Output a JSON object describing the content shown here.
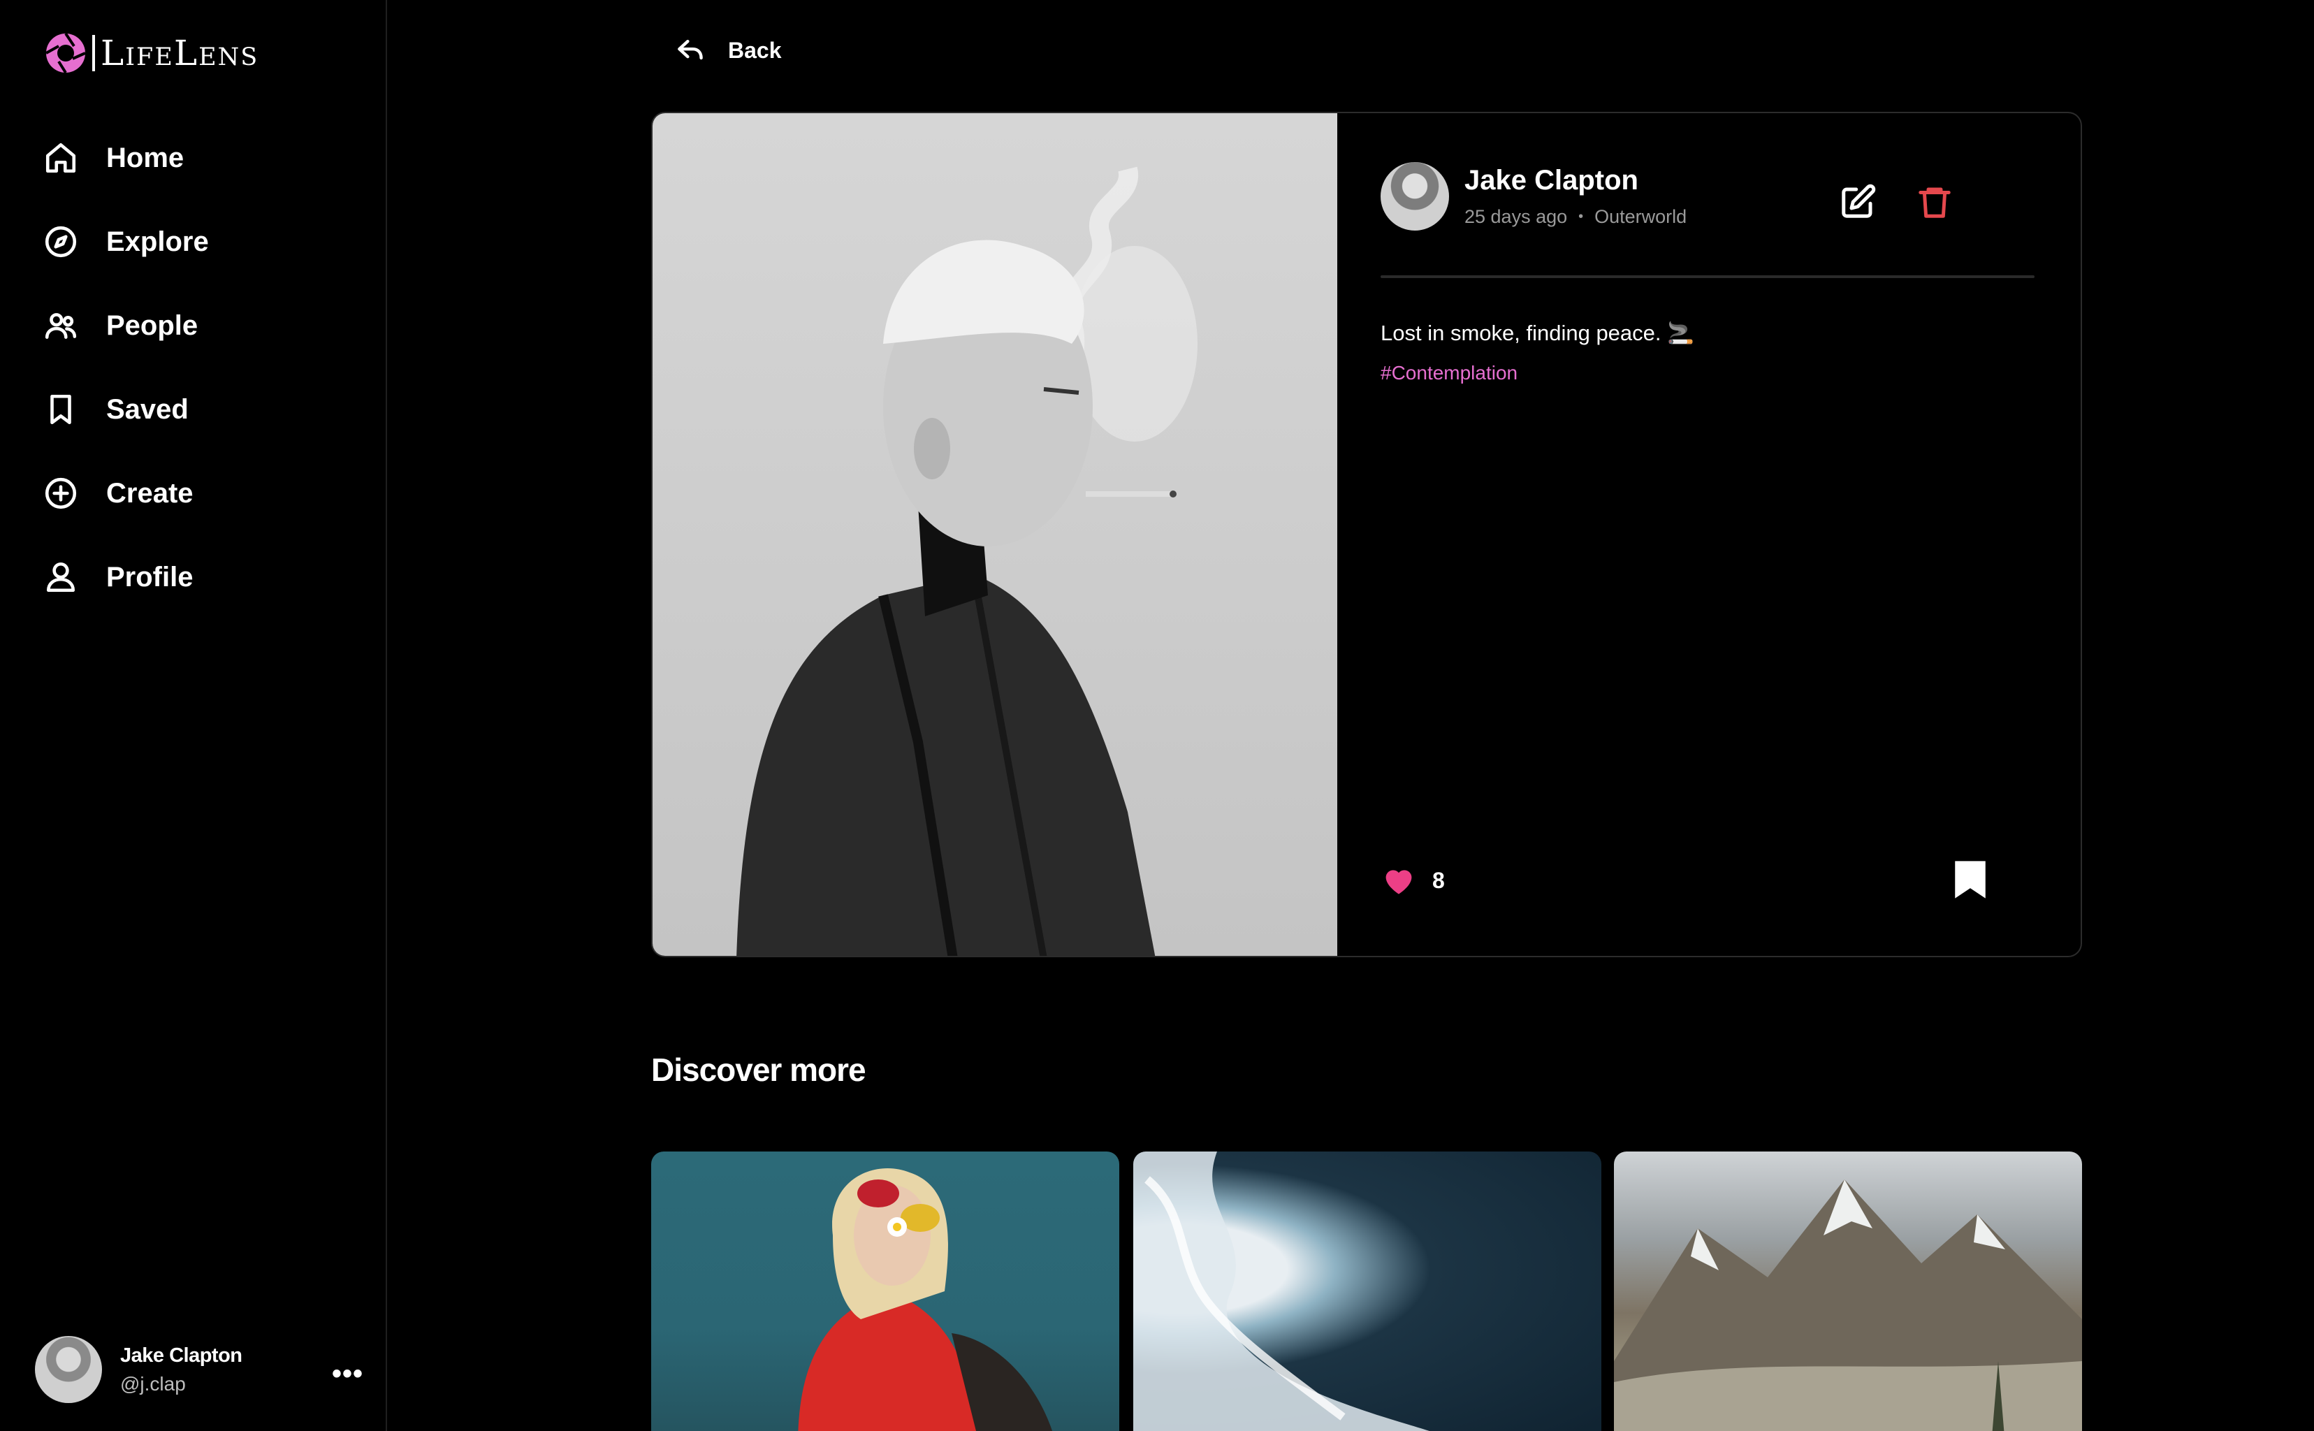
{
  "app": {
    "name": "LifeLens",
    "brand_color": "#e66fd0"
  },
  "sidebar": {
    "items": [
      {
        "label": "Home",
        "icon": "home-icon"
      },
      {
        "label": "Explore",
        "icon": "compass-icon"
      },
      {
        "label": "People",
        "icon": "people-icon"
      },
      {
        "label": "Saved",
        "icon": "bookmark-icon"
      },
      {
        "label": "Create",
        "icon": "plus-circle-icon"
      },
      {
        "label": "Profile",
        "icon": "user-icon"
      }
    ],
    "current_user": {
      "name": "Jake Clapton",
      "handle": "@j.clap",
      "more": "•••"
    }
  },
  "main": {
    "back_label": "Back",
    "post": {
      "author": "Jake Clapton",
      "time": "25 days ago",
      "separator": "•",
      "location": "Outerworld",
      "caption": "Lost in smoke, finding peace. 🚬",
      "hashtag": "#Contemplation",
      "likes": "8",
      "like_color": "#ec3f86",
      "delete_color": "#e5484d"
    },
    "discover_title": "Discover more"
  }
}
